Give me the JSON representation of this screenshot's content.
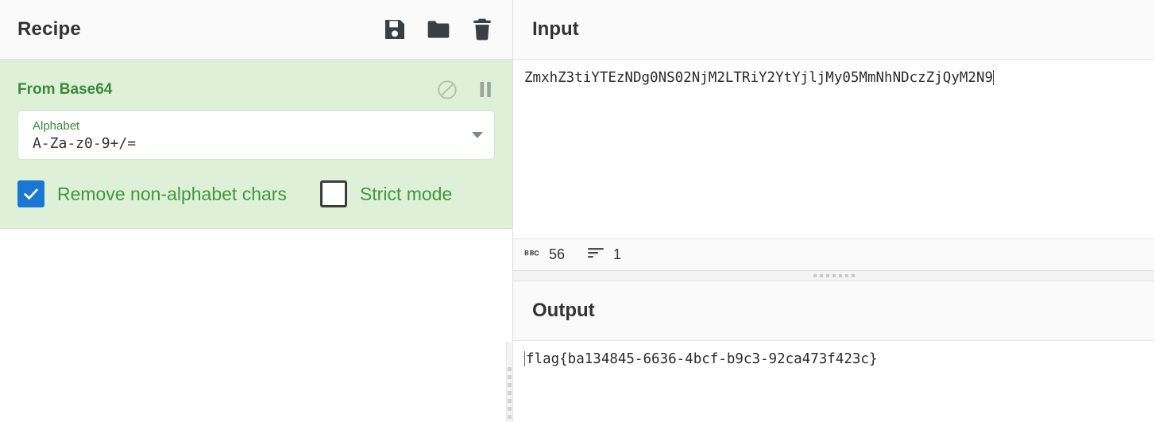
{
  "recipe": {
    "title": "Recipe",
    "icons": [
      {
        "name": "save-icon",
        "label": "Save recipe"
      },
      {
        "name": "folder-icon",
        "label": "Load recipe"
      },
      {
        "name": "trash-icon",
        "label": "Clear recipe"
      }
    ],
    "operations": [
      {
        "name": "From Base64",
        "disable_icon_label": "Disable operation",
        "breakpoint_icon_label": "Set breakpoint",
        "args": {
          "alphabet": {
            "label": "Alphabet",
            "value": "A-Za-z0-9+/="
          },
          "checkboxes": [
            {
              "label": "Remove non-alphabet chars",
              "checked": true
            },
            {
              "label": "Strict mode",
              "checked": false
            }
          ]
        }
      }
    ]
  },
  "input": {
    "title": "Input",
    "value": "ZmxhZ3tiYTEzNDg0NS02NjM2LTRiY2YtYjljMy05MmNhNDczZjQyM2N9",
    "status": {
      "length_icon": "abc-icon",
      "length": "56",
      "lines_icon": "lines-icon",
      "lines": "1"
    }
  },
  "output": {
    "title": "Output",
    "value": "flag{ba134845-6636-4bcf-b9c3-92ca473f423c}"
  },
  "colors": {
    "operation_bg": "#dff0d8",
    "operation_title": "#3a8a3a",
    "checkbox_checked": "#1a78d2",
    "header_bg": "#fafafa",
    "text": "#333333"
  }
}
